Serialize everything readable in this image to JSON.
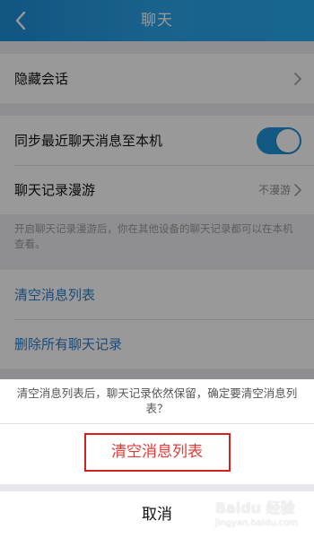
{
  "header": {
    "title": "聊天"
  },
  "settings": {
    "hidden_chat_label": "隐藏会话",
    "sync_label": "同步最近聊天消息至本机",
    "sync_enabled": true,
    "roaming_label": "聊天记录漫游",
    "roaming_value": "不漫游",
    "hint": "开启聊天记录漫游后，你在其他设备的聊天记录都可以在本机查看。",
    "clear_list_label": "清空消息列表",
    "delete_all_label": "删除所有聊天记录"
  },
  "sheet": {
    "message": "清空消息列表后，聊天记录依然保留，确定要清空消息列表？",
    "confirm_label": "清空消息列表",
    "cancel_label": "取消"
  },
  "watermark": {
    "text": "Baidu 经验",
    "subtext": "jingyan.baidu.com"
  },
  "colors": {
    "header_bg": "#1e8fd9",
    "toggle_on": "#1e94db",
    "link_blue": "#2f7ec7",
    "confirm_red": "#e53935"
  },
  "icons": {
    "back": "chevron-left-icon",
    "disclosure": "chevron-right-icon"
  }
}
